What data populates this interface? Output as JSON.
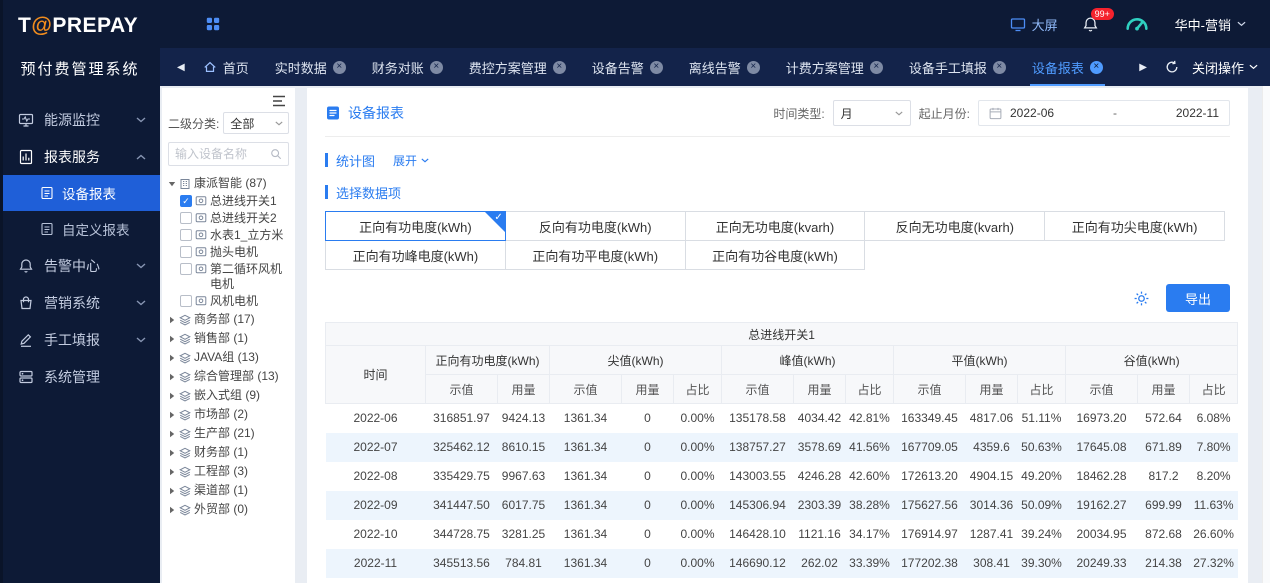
{
  "colors": {
    "accent_blue": "#2a7cf0",
    "sidebar_bg": "#0d1a36",
    "tabbar_bg": "#13234a",
    "active_menu_bg": "#1f5fd8",
    "badge_red": "#f5222d",
    "gauge_teal": "#2fd0c0",
    "logo_at_orange": "#f08c1e",
    "stripe_row": "#edf5fd"
  },
  "icons": {
    "scroll_left": "◀",
    "scroll_right": "▶",
    "close_glyph": "×",
    "check_glyph": "✓"
  },
  "app": {
    "logo_t": "T",
    "logo_at": "@",
    "logo_rest": "PREPAY",
    "subtitle": "预付费管理系统"
  },
  "topbar": {
    "big_screen": "大屏",
    "badge": "99+",
    "user": "华中-营销"
  },
  "tabs": {
    "close_menu": "关闭操作",
    "items": [
      {
        "label": "首页",
        "home": true,
        "closable": false
      },
      {
        "label": "实时数据",
        "closable": true
      },
      {
        "label": "财务对账",
        "closable": true
      },
      {
        "label": "费控方案管理",
        "closable": true
      },
      {
        "label": "设备告警",
        "closable": true
      },
      {
        "label": "离线告警",
        "closable": true
      },
      {
        "label": "计费方案管理",
        "closable": true
      },
      {
        "label": "设备手工填报",
        "closable": true
      },
      {
        "label": "设备报表",
        "closable": true,
        "active": true
      }
    ]
  },
  "sidebar": {
    "items": [
      {
        "key": "energy",
        "icon": "energy",
        "label": "能源监控",
        "expandable": true
      },
      {
        "key": "report",
        "icon": "report",
        "label": "报表服务",
        "expandable": true,
        "expanded": true,
        "children": [
          {
            "key": "device-report",
            "label": "设备报表",
            "active": true
          },
          {
            "key": "custom-report",
            "label": "自定义报表",
            "active": false
          }
        ]
      },
      {
        "key": "alarm",
        "icon": "alarm",
        "label": "告警中心",
        "expandable": true
      },
      {
        "key": "marketing",
        "icon": "marketing",
        "label": "营销系统",
        "expandable": true
      },
      {
        "key": "manual",
        "icon": "manual",
        "label": "手工填报",
        "expandable": true
      },
      {
        "key": "system",
        "icon": "system",
        "label": "系统管理",
        "expandable": false
      }
    ]
  },
  "device_panel": {
    "category_label": "二级分类:",
    "category_value": "全部",
    "search_placeholder": "输入设备名称",
    "tree": [
      {
        "label": "康派智能 (87)",
        "expanded": true,
        "children": [
          {
            "label": "总进线开关1",
            "checked": true
          },
          {
            "label": "总进线开关2",
            "checked": false
          },
          {
            "label": "水表1_立方米",
            "checked": false
          },
          {
            "label": "抛头电机",
            "checked": false
          },
          {
            "label": "第二循环风机电机",
            "checked": false
          },
          {
            "label": "风机电机",
            "checked": false
          }
        ]
      },
      {
        "label": "商务部 (17)"
      },
      {
        "label": "销售部 (1)"
      },
      {
        "label": "JAVA组 (13)"
      },
      {
        "label": "综合管理部 (13)"
      },
      {
        "label": "嵌入式组 (9)"
      },
      {
        "label": "市场部 (2)"
      },
      {
        "label": "生产部 (21)"
      },
      {
        "label": "财务部 (1)"
      },
      {
        "label": "工程部 (3)"
      },
      {
        "label": "渠道部 (1)"
      },
      {
        "label": "外贸部 (0)"
      }
    ]
  },
  "content": {
    "title": "设备报表",
    "time_type_label": "时间类型:",
    "time_type_value": "月",
    "range_label": "起止月份:",
    "range_start": "2022-06",
    "range_separator": "-",
    "range_end": "2022-11",
    "stats_section": "统计图",
    "expand_label": "展开",
    "data_section": "选择数据项",
    "export_label": "导出",
    "data_items": [
      {
        "label": "正向有功电度(kWh)",
        "selected": true
      },
      {
        "label": "反向有功电度(kWh)",
        "selected": false
      },
      {
        "label": "正向无功电度(kvarh)",
        "selected": false
      },
      {
        "label": "反向无功电度(kvarh)",
        "selected": false
      },
      {
        "label": "正向有功尖电度(kWh)",
        "selected": false
      },
      {
        "label": "正向有功峰电度(kWh)",
        "selected": false
      },
      {
        "label": "正向有功平电度(kWh)",
        "selected": false
      },
      {
        "label": "正向有功谷电度(kWh)",
        "selected": false
      }
    ]
  },
  "table": {
    "device_header": "总进线开关1",
    "time_header": "时间",
    "groups": [
      {
        "label": "正向有功电度(kWh)",
        "cols": [
          "示值",
          "用量"
        ]
      },
      {
        "label": "尖值(kWh)",
        "cols": [
          "示值",
          "用量",
          "占比"
        ]
      },
      {
        "label": "峰值(kWh)",
        "cols": [
          "示值",
          "用量",
          "占比"
        ]
      },
      {
        "label": "平值(kWh)",
        "cols": [
          "示值",
          "用量",
          "占比"
        ]
      },
      {
        "label": "谷值(kWh)",
        "cols": [
          "示值",
          "用量",
          "占比"
        ]
      }
    ],
    "rows": [
      [
        "2022-06",
        "316851.97",
        "9424.13",
        "1361.34",
        "0",
        "0.00%",
        "135178.58",
        "4034.42",
        "42.81%",
        "163349.45",
        "4817.06",
        "51.11%",
        "16973.20",
        "572.64",
        "6.08%"
      ],
      [
        "2022-07",
        "325462.12",
        "8610.15",
        "1361.34",
        "0",
        "0.00%",
        "138757.27",
        "3578.69",
        "41.56%",
        "167709.05",
        "4359.6",
        "50.63%",
        "17645.08",
        "671.89",
        "7.80%"
      ],
      [
        "2022-08",
        "335429.75",
        "9967.63",
        "1361.34",
        "0",
        "0.00%",
        "143003.55",
        "4246.28",
        "42.60%",
        "172613.20",
        "4904.15",
        "49.20%",
        "18462.28",
        "817.2",
        "8.20%"
      ],
      [
        "2022-09",
        "341447.50",
        "6017.75",
        "1361.34",
        "0",
        "0.00%",
        "145306.94",
        "2303.39",
        "38.28%",
        "175627.56",
        "3014.36",
        "50.09%",
        "19162.27",
        "699.99",
        "11.63%"
      ],
      [
        "2022-10",
        "344728.75",
        "3281.25",
        "1361.34",
        "0",
        "0.00%",
        "146428.10",
        "1121.16",
        "34.17%",
        "176914.97",
        "1287.41",
        "39.24%",
        "20034.95",
        "872.68",
        "26.60%"
      ],
      [
        "2022-11",
        "345513.56",
        "784.81",
        "1361.34",
        "0",
        "0.00%",
        "146690.12",
        "262.02",
        "33.39%",
        "177202.38",
        "308.41",
        "39.30%",
        "20249.33",
        "214.38",
        "27.32%"
      ]
    ]
  }
}
